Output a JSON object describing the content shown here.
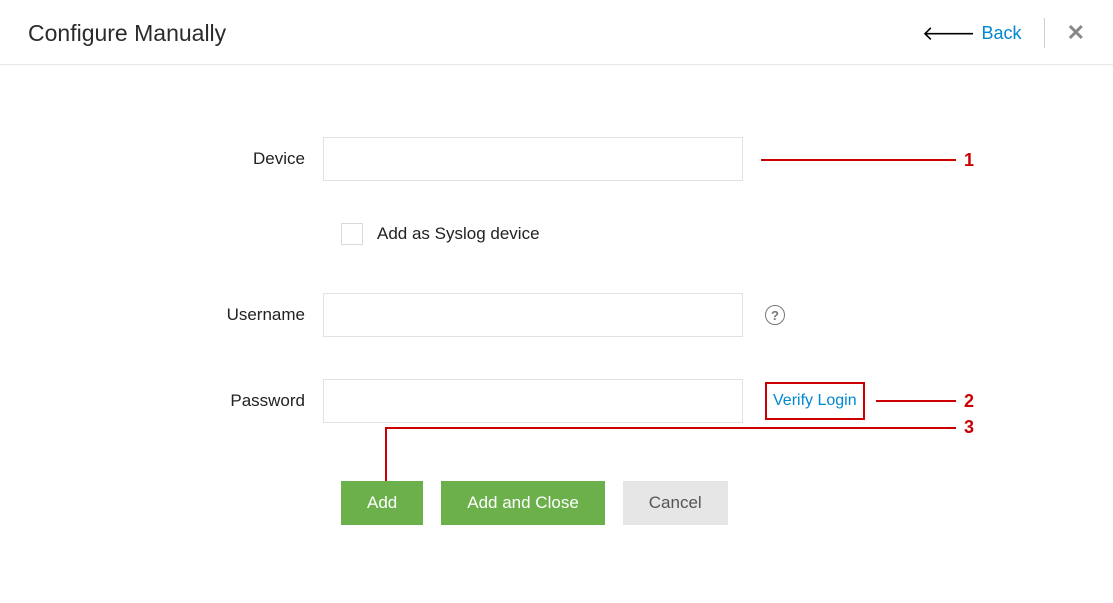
{
  "header": {
    "title": "Configure Manually",
    "back_label": "Back"
  },
  "form": {
    "device_label": "Device",
    "device_value": "",
    "syslog_label": "Add as Syslog device",
    "username_label": "Username",
    "username_value": "",
    "password_label": "Password",
    "password_value": "",
    "verify_label": "Verify Login"
  },
  "buttons": {
    "add": "Add",
    "add_close": "Add and Close",
    "cancel": "Cancel"
  },
  "callouts": {
    "c1": "1",
    "c2": "2",
    "c3": "3"
  }
}
